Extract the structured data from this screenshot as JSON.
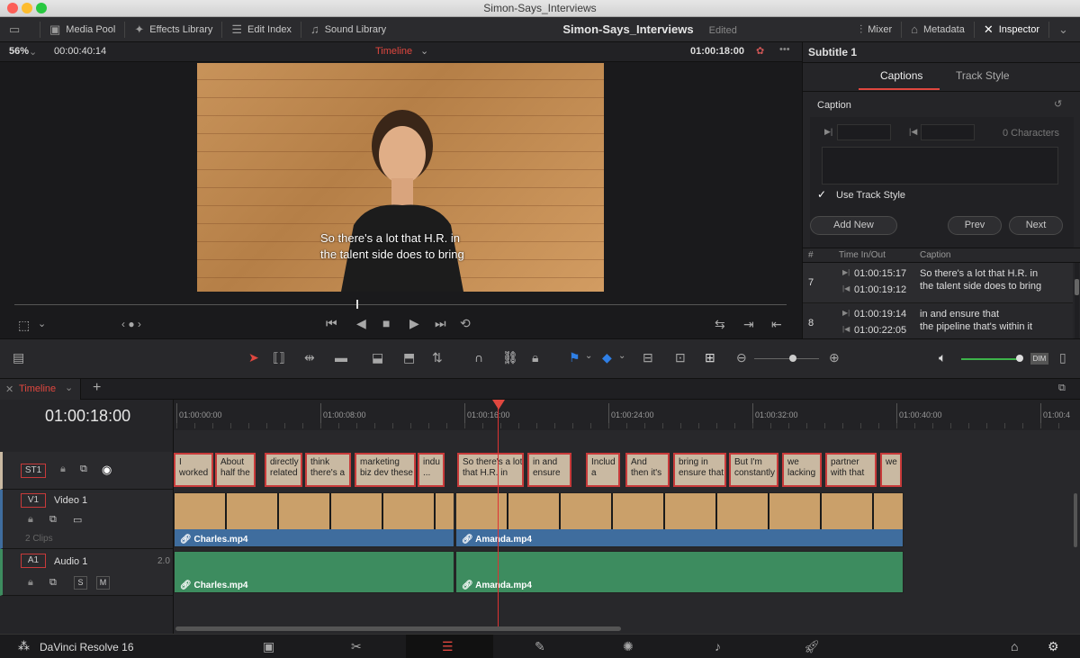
{
  "window": {
    "title": "Simon-Says_Interviews"
  },
  "toolbar": {
    "media_pool": "Media Pool",
    "effects_library": "Effects Library",
    "edit_index": "Edit Index",
    "sound_library": "Sound Library",
    "project_name": "Simon-Says_Interviews",
    "project_status": "Edited",
    "mixer": "Mixer",
    "metadata": "Metadata",
    "inspector": "Inspector"
  },
  "viewer": {
    "zoom": "56%",
    "source_timecode": "00:00:40:14",
    "timeline_label": "Timeline",
    "timecode": "01:00:18:00",
    "subtitle_line1": "So there's a lot that H.R. in",
    "subtitle_line2": "the talent side does to bring"
  },
  "inspector": {
    "title": "Subtitle 1",
    "tab_captions": "Captions",
    "tab_track_style": "Track Style",
    "section": "Caption",
    "char_count": "0 Characters",
    "use_track_style": "Use Track Style",
    "add_new": "Add New",
    "prev": "Prev",
    "next": "Next",
    "col_num": "#",
    "col_time": "Time In/Out",
    "col_caption": "Caption",
    "rows": [
      {
        "num": "7",
        "in": "01:00:15:17",
        "out": "01:00:19:12",
        "line1": "So there's a lot that H.R. in",
        "line2": "the talent side does to bring"
      },
      {
        "num": "8",
        "in": "01:00:19:14",
        "out": "01:00:22:05",
        "line1": "in and ensure that",
        "line2": "the pipeline that's within it"
      }
    ]
  },
  "timeline": {
    "tab": "Timeline",
    "current_timecode": "01:00:18:00",
    "ruler": [
      "01:00:00:00",
      "01:00:08:00",
      "01:00:16:00",
      "01:00:24:00",
      "01:00:32:00",
      "01:00:40:00",
      "01:00:4"
    ],
    "tracks": {
      "st1": "ST1",
      "v1": "V1",
      "v1_name": "Video 1",
      "v1_clips": "2 Clips",
      "a1": "A1",
      "a1_name": "Audio 1",
      "a1_ch": "2.0",
      "solo": "S",
      "mute": "M"
    },
    "subtitles": [
      {
        "l1": "I",
        "l2": "worked"
      },
      {
        "l1": "About",
        "l2": "half the"
      },
      {
        "l1": "directly",
        "l2": "related"
      },
      {
        "l1": "think",
        "l2": "there's a"
      },
      {
        "l1": "marketing",
        "l2": "biz dev these"
      },
      {
        "l1": "indu",
        "l2": "..."
      },
      {
        "l1": "So there's a lot",
        "l2": "that H.R. in"
      },
      {
        "l1": "in and",
        "l2": "ensure"
      },
      {
        "l1": "Includ",
        "l2": "a"
      },
      {
        "l1": "And",
        "l2": "then it's"
      },
      {
        "l1": "bring in",
        "l2": "ensure that"
      },
      {
        "l1": "But I'm",
        "l2": "constantly"
      },
      {
        "l1": "we",
        "l2": "lacking"
      },
      {
        "l1": "partner",
        "l2": "with that"
      },
      {
        "l1": "we",
        "l2": ""
      }
    ],
    "video_clips": [
      "Charles.mp4",
      "Amanda.mp4"
    ],
    "audio_clips": [
      "Charles.mp4",
      "Amanda.mp4"
    ]
  },
  "footer": {
    "app_name": "DaVinci Resolve 16"
  }
}
